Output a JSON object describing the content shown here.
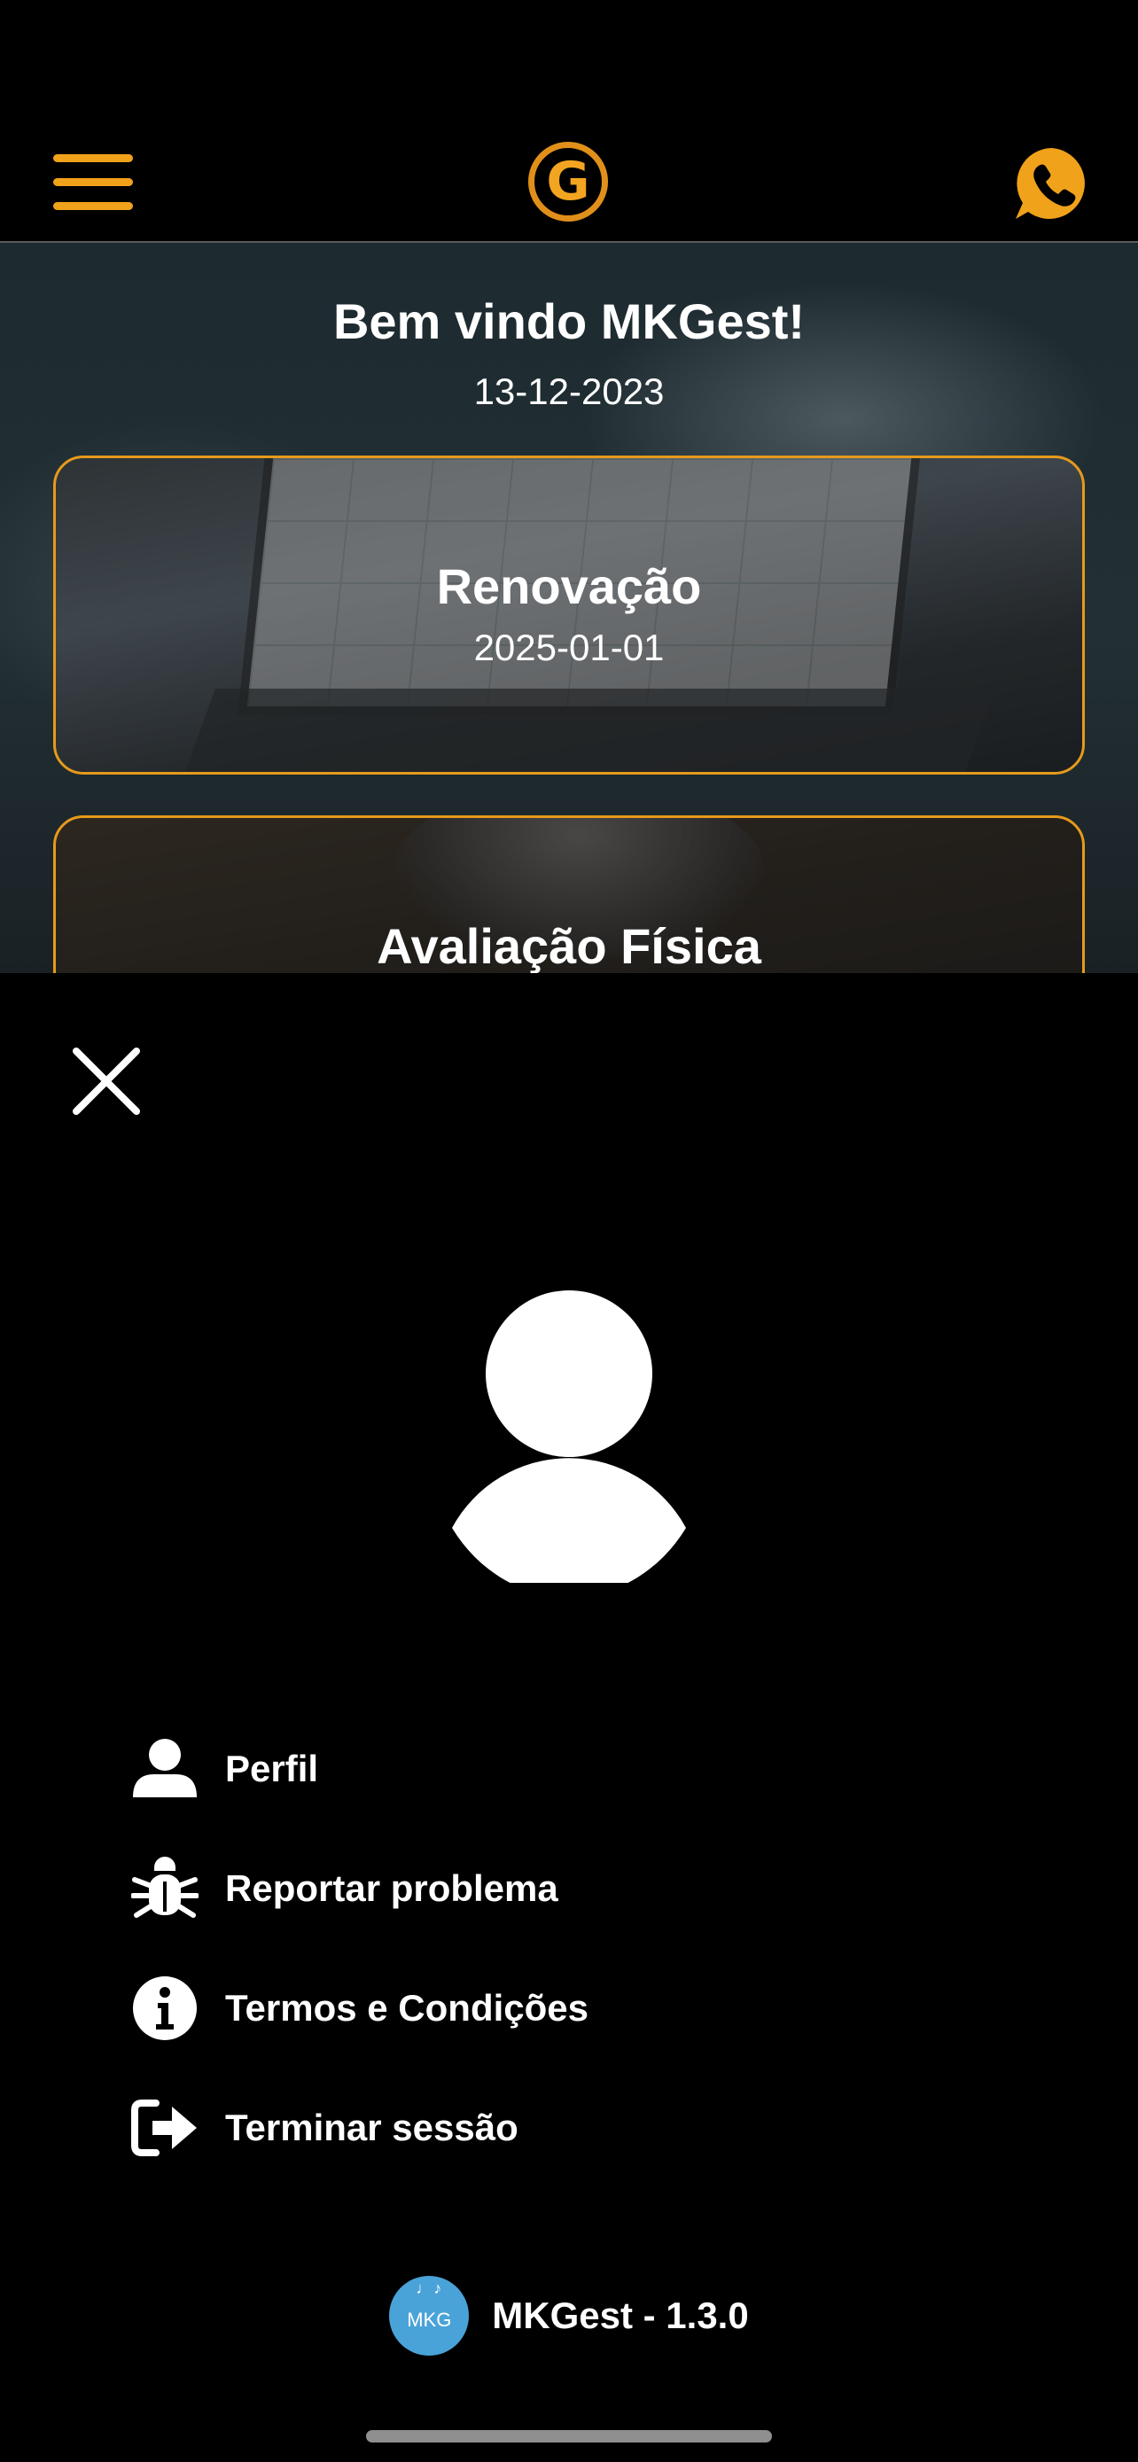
{
  "header": {
    "menu_icon": "hamburger-icon",
    "logo_letter": "G",
    "phone_icon": "whatsapp-phone-icon",
    "accent_color": "#f0a21a"
  },
  "home": {
    "welcome": "Bem vindo MKGest!",
    "date": "13-12-2023",
    "cards": [
      {
        "title": "Renovação",
        "subtitle": "2025-01-01"
      },
      {
        "title": "Avaliação Física"
      }
    ]
  },
  "drawer": {
    "close_icon": "close-icon",
    "avatar_icon": "user-avatar-icon",
    "menu": [
      {
        "label": "Perfil",
        "icon": "user-icon"
      },
      {
        "label": "Reportar problema",
        "icon": "bug-icon"
      },
      {
        "label": "Termos e Condições",
        "icon": "info-icon"
      },
      {
        "label": "Terminar sessão",
        "icon": "logout-icon"
      }
    ],
    "footer": {
      "badge_text": "MKG",
      "version": "MKGest - 1.3.0",
      "badge_color": "#4aa3d8"
    }
  }
}
